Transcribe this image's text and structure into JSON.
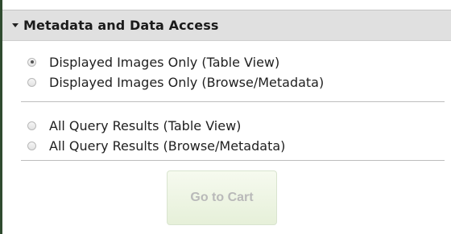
{
  "section": {
    "title": "Metadata and Data Access"
  },
  "options": [
    {
      "label": "Displayed Images Only (Table View)",
      "checked": true
    },
    {
      "label": "Displayed Images Only (Browse/Metadata)",
      "checked": false
    },
    {
      "label": "All Query Results (Table View)",
      "checked": false
    },
    {
      "label": "All Query Results (Browse/Metadata)",
      "checked": false
    }
  ],
  "cart_button": {
    "label": "Go to Cart",
    "enabled": false
  },
  "colors": {
    "header_background": "#e0e0e0",
    "button_background": "#e6f0d9",
    "button_text_disabled": "#b9b9b9"
  }
}
